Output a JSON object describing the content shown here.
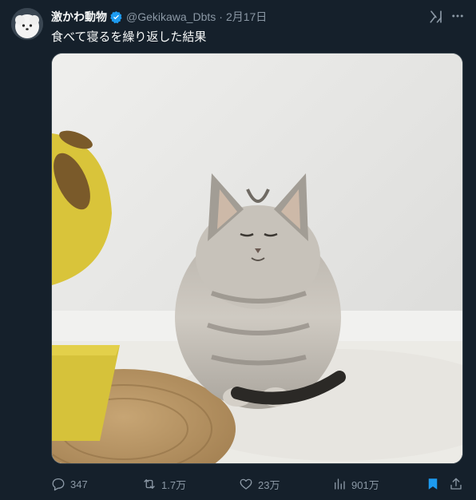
{
  "author": {
    "display_name": "激かわ動物",
    "handle": "@Gekikawa_Dbts",
    "separator": "·",
    "date": "2月17日",
    "verified": true
  },
  "tweet": {
    "text": "食べて寝るを繰り返した結果"
  },
  "icons": {
    "avatar": "white-fluffy-dog-avatar",
    "verified": "verified-badge-icon",
    "grok": "grok-icon",
    "more": "more-icon",
    "reply": "reply-icon",
    "retweet": "retweet-icon",
    "like": "like-icon",
    "views": "views-icon",
    "bookmark": "bookmark-icon",
    "share": "share-icon"
  },
  "metrics": {
    "replies": "347",
    "retweets": "1.7万",
    "likes": "23万",
    "views": "901万"
  },
  "colors": {
    "background": "#15202b",
    "secondary_text": "#8b98a5",
    "accent": "#1d9bf0"
  }
}
